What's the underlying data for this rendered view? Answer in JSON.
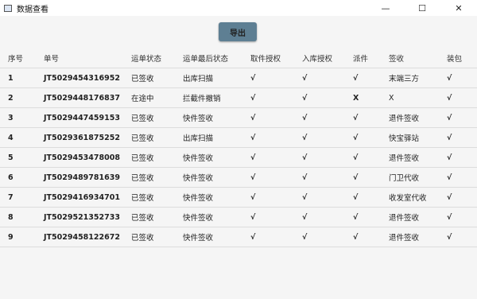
{
  "window": {
    "title": "数据查看",
    "controls": {
      "minimize": "—",
      "maximize": "☐",
      "close": "✕"
    }
  },
  "toolbar": {
    "export_label": "导出"
  },
  "table": {
    "columns": [
      "序号",
      "单号",
      "运单状态",
      "运单最后状态",
      "取件授权",
      "入库授权",
      "派件",
      "签收",
      "装包"
    ],
    "rows": [
      {
        "num": "1",
        "code": "JT5029454316952",
        "status": "已签收",
        "last": "出库扫描",
        "pickup": "√",
        "inbound": "√",
        "dispatch": "√",
        "sign": "末端三方",
        "pack": "√"
      },
      {
        "num": "2",
        "code": "JT5029448176837",
        "status": "在途中",
        "last": "拦截件撤销",
        "pickup": "√",
        "inbound": "√",
        "dispatch": "X",
        "sign": "X",
        "pack": "√"
      },
      {
        "num": "3",
        "code": "JT5029447459153",
        "status": "已签收",
        "last": "快件签收",
        "pickup": "√",
        "inbound": "√",
        "dispatch": "√",
        "sign": "退件签收",
        "pack": "√"
      },
      {
        "num": "4",
        "code": "JT5029361875252",
        "status": "已签收",
        "last": "出库扫描",
        "pickup": "√",
        "inbound": "√",
        "dispatch": "√",
        "sign": "快宝驿站",
        "pack": "√"
      },
      {
        "num": "5",
        "code": "JT5029453478008",
        "status": "已签收",
        "last": "快件签收",
        "pickup": "√",
        "inbound": "√",
        "dispatch": "√",
        "sign": "退件签收",
        "pack": "√"
      },
      {
        "num": "6",
        "code": "JT5029489781639",
        "status": "已签收",
        "last": "快件签收",
        "pickup": "√",
        "inbound": "√",
        "dispatch": "√",
        "sign": "门卫代收",
        "pack": "√"
      },
      {
        "num": "7",
        "code": "JT5029416934701",
        "status": "已签收",
        "last": "快件签收",
        "pickup": "√",
        "inbound": "√",
        "dispatch": "√",
        "sign": "收发室代收",
        "pack": "√"
      },
      {
        "num": "8",
        "code": "JT5029521352733",
        "status": "已签收",
        "last": "快件签收",
        "pickup": "√",
        "inbound": "√",
        "dispatch": "√",
        "sign": "退件签收",
        "pack": "√"
      },
      {
        "num": "9",
        "code": "JT5029458122672",
        "status": "已签收",
        "last": "快件签收",
        "pickup": "√",
        "inbound": "√",
        "dispatch": "√",
        "sign": "退件签收",
        "pack": "√"
      }
    ]
  }
}
